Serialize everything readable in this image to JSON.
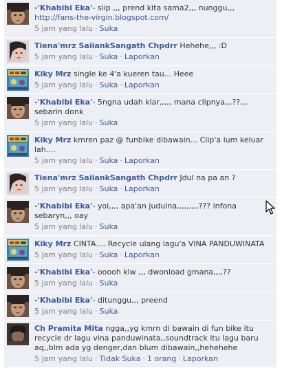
{
  "comments": [
    {
      "author": "-'Khabibi Eka'",
      "avatar": "face-photo",
      "text": "- siip ,,, prend kita sama2,,, nunggu,,, ",
      "link": "http://fans-the-virgin.blogspot.com/",
      "time": "5 jam yang lalu",
      "actions": [
        "Suka"
      ]
    },
    {
      "author": "Tiena'mrz SaiiankSangath Chpdrr",
      "avatar": "girl-photo",
      "text": " Hehehe,,, :D",
      "time": "5 jam yang lalu",
      "actions": [
        "Suka",
        "Laporkan"
      ]
    },
    {
      "author": "Kiky Mrz",
      "avatar": "poster-photo",
      "text": " single ke 4'a kueren tau... Heee",
      "time": "5 jam yang lalu",
      "actions": [
        "Suka",
        "Laporkan"
      ]
    },
    {
      "author": "-'Khabibi Eka'",
      "avatar": "face-photo",
      "text": "- 5ngna udah klar,,,,, mana clipnya,,,??,,, sebarin donk",
      "time": "5 jam yang lalu",
      "actions": [
        "Suka"
      ]
    },
    {
      "author": "Kiky Mrz",
      "avatar": "poster-photo",
      "text": " kmren paz @ funbike dibawain... Clip'a lum keluar lah....",
      "time": "5 jam yang lalu",
      "actions": [
        "Suka",
        "Laporkan"
      ]
    },
    {
      "author": "Tiena'mrz SaiiankSangath Chpdrr",
      "avatar": "girl-photo",
      "text": " Jdul na pa an ?",
      "time": "5 jam yang lalu",
      "actions": [
        "Suka",
        "Laporkan"
      ]
    },
    {
      "author": "-'Khabibi Eka'",
      "avatar": "face-photo",
      "text": "- yoi,,,, apa'an judulna,,,,,,,,,??? infona sebaryn,,, oay",
      "time": "5 jam yang lalu",
      "actions": [
        "Suka"
      ]
    },
    {
      "author": "Kiky Mrz",
      "avatar": "poster-photo",
      "text": " CINTA.... Recycle ulang lagu'a VINA PANDUWINATA",
      "time": "5 jam yang lalu",
      "actions": [
        "Suka",
        "Laporkan"
      ]
    },
    {
      "author": "-'Khabibi Eka'",
      "avatar": "face-photo",
      "text": "- ooooh klw ,,, dwonload gmana,,,,??",
      "time": "5 jam yang lalu",
      "actions": [
        "Suka"
      ]
    },
    {
      "author": "-'Khabibi Eka'",
      "avatar": "face-photo",
      "text": "- ditunggu,,, preend",
      "time": "5 jam yang lalu",
      "actions": [
        "Suka"
      ]
    },
    {
      "author": "Ch Pramita Mita",
      "avatar": "dark-photo",
      "text": " ngga,,yg kmrn di bawain di fun bike itu recycle dr lagu vina panduwinata,,soundtrack itu lagu baru aq,,blm ada yg denger,dan blum dibawain,,hehehehe",
      "time": "5 jam yang lalu",
      "actions": [
        "Tidak Suka",
        "1 orang",
        "Laporkan"
      ]
    }
  ],
  "colors": {
    "link": "#3b5998",
    "comment_bg": "#edeff4",
    "meta": "#808080"
  }
}
